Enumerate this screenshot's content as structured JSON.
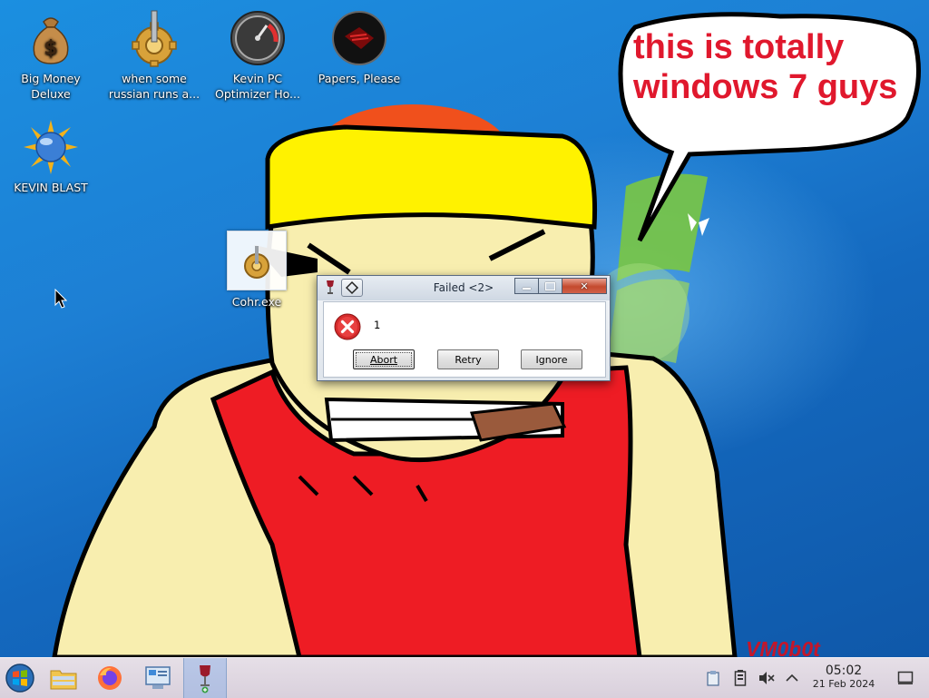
{
  "desktop": {
    "icons": [
      {
        "label": "Big Money\nDeluxe",
        "icon": "money-bag-icon"
      },
      {
        "label": "when some\nrussian runs a...",
        "icon": "gear-icon"
      },
      {
        "label": "Kevin PC\nOptimizer Ho...",
        "icon": "speedometer-icon"
      },
      {
        "label": "Papers, Please",
        "icon": "papers-please-icon"
      },
      {
        "label": "KEVIN BLAST",
        "icon": "sun-globe-icon"
      },
      {
        "label": "Cohr.exe",
        "icon": "gear-icon"
      }
    ],
    "speech_bubble": "this is totally\nwindows 7 guys",
    "watermark": "VM0b0t"
  },
  "dialog": {
    "title": "Failed <2>",
    "message": "1",
    "buttons": {
      "abort": "Abort",
      "retry": "Retry",
      "ignore": "Ignore"
    },
    "title_buttons": {
      "minimize": "minimize-icon",
      "maximize": "maximize-icon",
      "close": "close-icon"
    }
  },
  "taskbar": {
    "items": [
      "start-orb-icon",
      "file-manager-icon",
      "firefox-icon",
      "control-panel-icon",
      "wine-app-icon"
    ],
    "tray": [
      "clipboard-icon",
      "battery-icon",
      "speaker-muted-icon",
      "chevron-up-icon"
    ],
    "clock": {
      "time": "05:02",
      "date": "21 Feb 2024"
    },
    "show_desktop": "show-desktop-icon"
  }
}
